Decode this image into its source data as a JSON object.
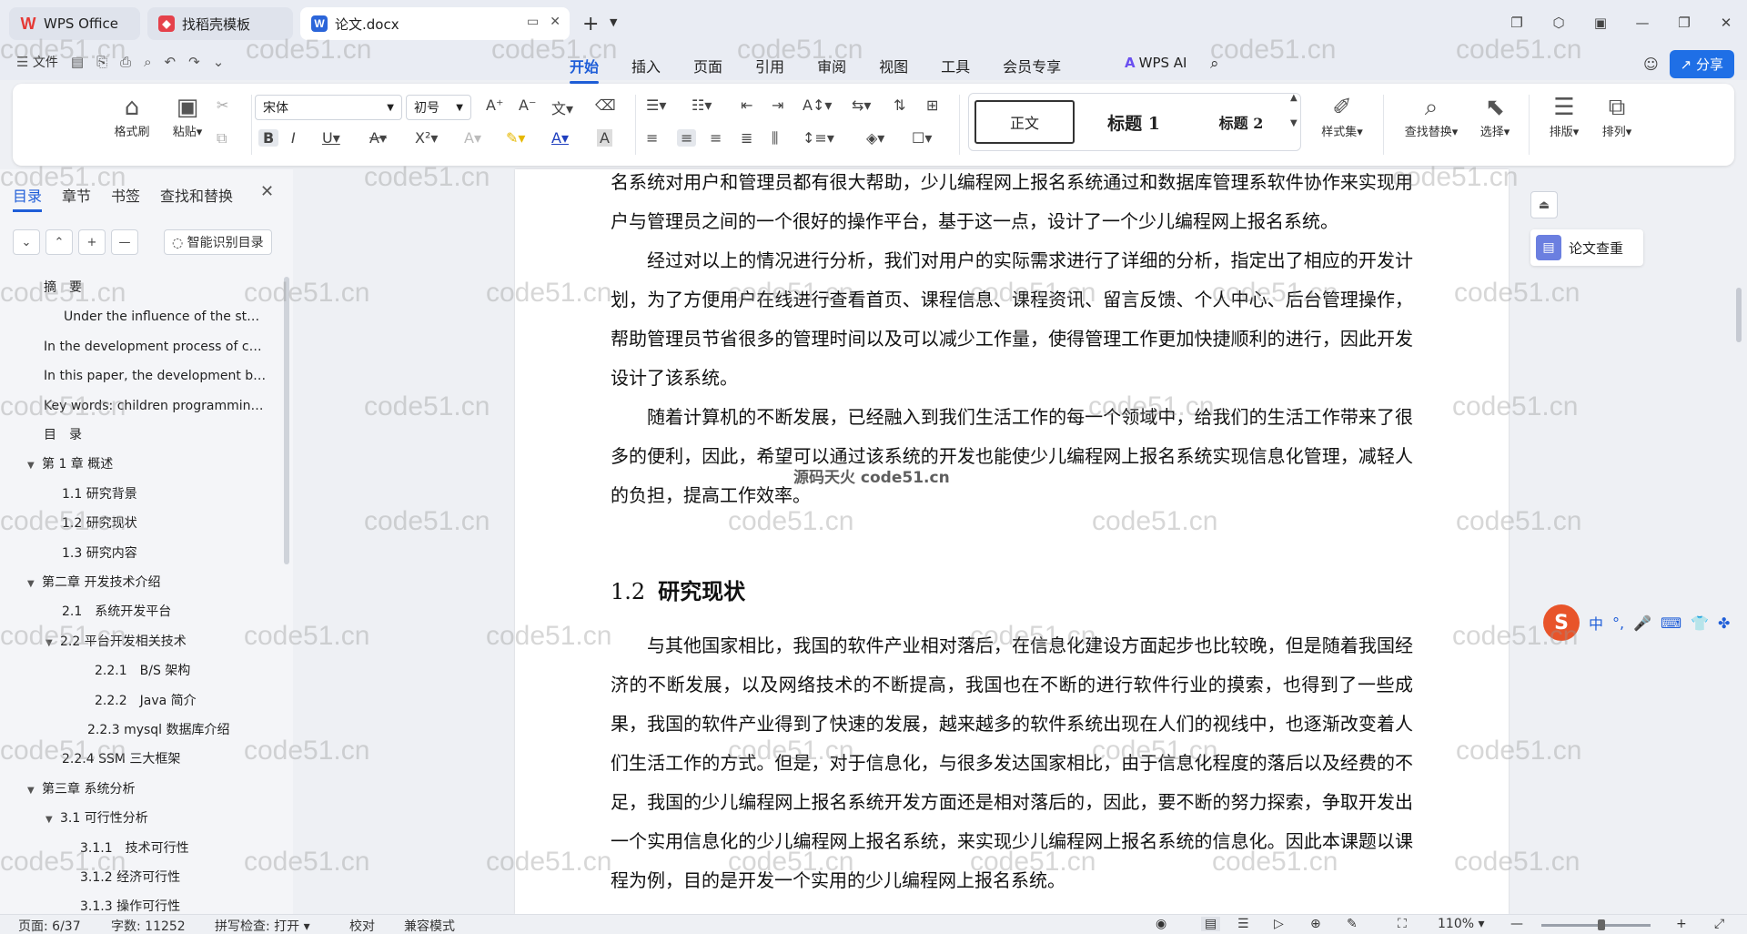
{
  "titlebar": {
    "tabs": [
      {
        "label": "WPS Office"
      },
      {
        "label": "找稻壳模板"
      },
      {
        "label": "论文.docx"
      }
    ]
  },
  "menu": {
    "file": "文件",
    "items": [
      "开始",
      "插入",
      "页面",
      "引用",
      "审阅",
      "视图",
      "工具",
      "会员专享"
    ],
    "wps_ai": "WPS AI",
    "share": "分享"
  },
  "ribbon": {
    "format_painter": "格式刷",
    "paste": "粘贴",
    "font_name": "宋体",
    "font_size": "初号",
    "styles": [
      "正文",
      "标题 1",
      "标题 2"
    ],
    "style_set": "样式集",
    "find_replace": "查找替换",
    "select": "选择",
    "layout": "排版",
    "arrange": "排列"
  },
  "nav": {
    "tabs": [
      "目录",
      "章节",
      "书签",
      "查找和替换"
    ],
    "smart_toc": "智能识别目录",
    "toc": [
      {
        "text": "摘　要",
        "level": 1
      },
      {
        "text": "Under the influence of the st…",
        "level": 2
      },
      {
        "text": "In the development process of c…",
        "level": 1
      },
      {
        "text": "In this paper, the development b…",
        "level": 1
      },
      {
        "text": "Key words: children programmin…",
        "level": 1
      },
      {
        "text": "目　录",
        "level": 1
      },
      {
        "text": "第 1 章 概述",
        "level": 1
      },
      {
        "text": "1.1 研究背景",
        "level": 2
      },
      {
        "text": "1.2 研究现状",
        "level": 2
      },
      {
        "text": "1.3 研究内容",
        "level": 2
      },
      {
        "text": "第二章 开发技术介绍",
        "level": 1
      },
      {
        "text": "2.1　系统开发平台",
        "level": 2
      },
      {
        "text": "2.2 平台开发相关技术",
        "level": 2
      },
      {
        "text": "2.2.1　B/S 架构",
        "level": 3
      },
      {
        "text": "2.2.2　Java 简介",
        "level": 3
      },
      {
        "text": "2.2.3 mysql 数据库介绍",
        "level": 3
      },
      {
        "text": "2.2.4 SSM 三大框架",
        "level": 2
      },
      {
        "text": "第三章 系统分析",
        "level": 1
      },
      {
        "text": "3.1 可行性分析",
        "level": 2
      },
      {
        "text": "3.1.1　技术可行性",
        "level": 3
      },
      {
        "text": "3.1.2 经济可行性",
        "level": 3
      },
      {
        "text": "3.1.3 操作可行性",
        "level": 3
      }
    ]
  },
  "document": {
    "p1": "名系统对用户和管理员都有很大帮助，少儿编程网上报名系统通过和数据库管理系软件协作来实现用户与管理员之间的一个很好的操作平台，基于这一点，设计了一个少儿编程网上报名系统。",
    "p2": "经过对以上的情况进行分析，我们对用户的实际需求进行了详细的分析，指定出了相应的开发计划，为了方便用户在线进行查看首页、课程信息、课程资讯、留言反馈、个人中心、后台管理操作，帮助管理员节省很多的管理时间以及可以减少工作量，使得管理工作更加快捷顺利的进行，因此开发设计了该系统。",
    "p3": "随着计算机的不断发展，已经融入到我们生活工作的每一个领域中，给我们的生活工作带来了很多的便利，因此，希望可以通过该系统的开发也能使少儿编程网上报名系统实现信息化管理，减轻人的负担，提高工作效率。",
    "overlay": "源码天火 code51.cn",
    "heading_num": "1.2",
    "heading_text": "研究现状",
    "p4": "与其他国家相比，我国的软件产业相对落后，在信息化建设方面起步也比较晚，但是随着我国经济的不断发展，以及网络技术的不断提高，我国也在不断的进行软件行业的摸索，也得到了一些成果，我国的软件产业得到了快速的发展，越来越多的软件系统出现在人们的视线中，也逐渐改变着人们生活工作的方式。但是，对于信息化，与很多发达国家相比，由于信息化程度的落后以及经费的不足，我国的少儿编程网上报名系统开发方面还是相对落后的，因此，要不断的努力探索，争取开发出一个实用信息化的少儿编程网上报名系统，来实现少儿编程网上报名系统的信息化。因此本课题以课程为例，目的是开发一个实用的少儿编程网上报名系统。"
  },
  "side": {
    "essay_check": "论文查重",
    "ime_cn": "中"
  },
  "watermark": "code51.cn",
  "status": {
    "page": "页面: 6/37",
    "words": "字数: 11252",
    "spell": "拼写检查: 打开",
    "proof": "校对",
    "compat": "兼容模式",
    "zoom": "110%"
  }
}
